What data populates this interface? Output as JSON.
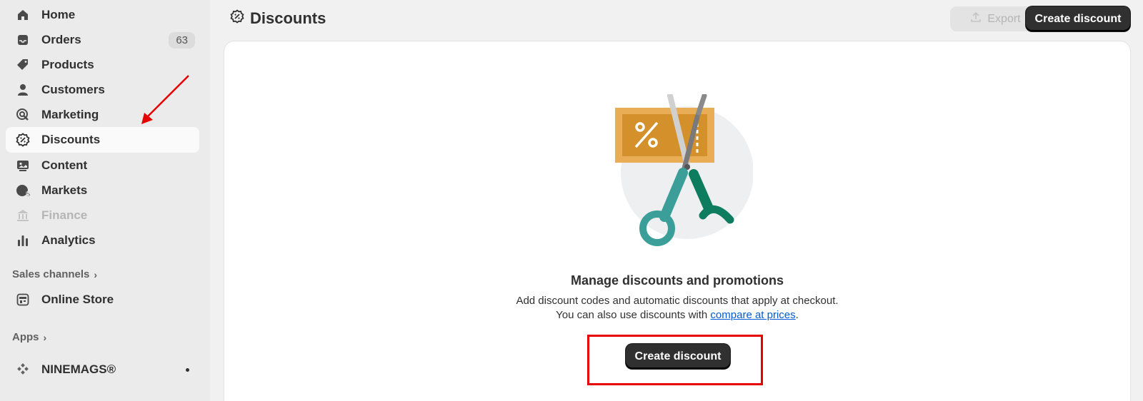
{
  "sidebar": {
    "items": [
      {
        "label": "Home",
        "icon": "home-icon"
      },
      {
        "label": "Orders",
        "icon": "orders-icon",
        "badge": "63"
      },
      {
        "label": "Products",
        "icon": "tag-icon"
      },
      {
        "label": "Customers",
        "icon": "person-icon"
      },
      {
        "label": "Marketing",
        "icon": "target-icon"
      },
      {
        "label": "Discounts",
        "icon": "discount-icon",
        "active": true
      },
      {
        "label": "Content",
        "icon": "content-icon"
      },
      {
        "label": "Markets",
        "icon": "globe-icon"
      },
      {
        "label": "Finance",
        "icon": "bank-icon",
        "disabled": true
      },
      {
        "label": "Analytics",
        "icon": "bar-chart-icon"
      }
    ],
    "sales_channels_label": "Sales channels",
    "online_store_label": "Online Store",
    "apps_label": "Apps",
    "app_name": "NINEMAGS®"
  },
  "header": {
    "title": "Discounts",
    "export_label": "Export",
    "create_label": "Create discount"
  },
  "empty_state": {
    "title": "Manage discounts and promotions",
    "desc_line1": "Add discount codes and automatic discounts that apply at checkout.",
    "desc_line2_prefix": "You can also use discounts with ",
    "desc_link": "compare at prices",
    "desc_line2_suffix": ".",
    "button_label": "Create discount"
  },
  "colors": {
    "primary_button": "#303030",
    "link": "#005bd3",
    "annotation": "#e60000"
  }
}
